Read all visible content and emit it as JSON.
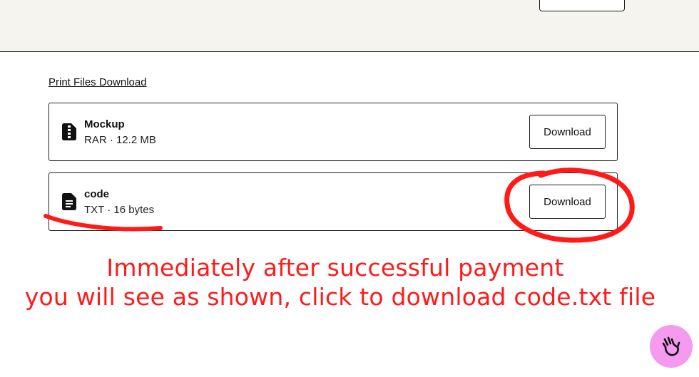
{
  "header": {
    "button_label": ""
  },
  "downloads": {
    "section_link": "Print Files Download",
    "files": [
      {
        "name": "Mockup",
        "meta": "RAR · 12.2 MB",
        "button": "Download",
        "icon": "archive-file-icon"
      },
      {
        "name": "code",
        "meta": "TXT · 16 bytes",
        "button": "Download",
        "icon": "text-file-icon"
      }
    ]
  },
  "annotation": {
    "line1": "Immediately after successful payment",
    "line2": "you will see as shown, click to download code.txt file",
    "color": "#ff1a1a"
  },
  "help": {
    "icon": "waving-hand-icon",
    "color": "#f49bf0"
  }
}
